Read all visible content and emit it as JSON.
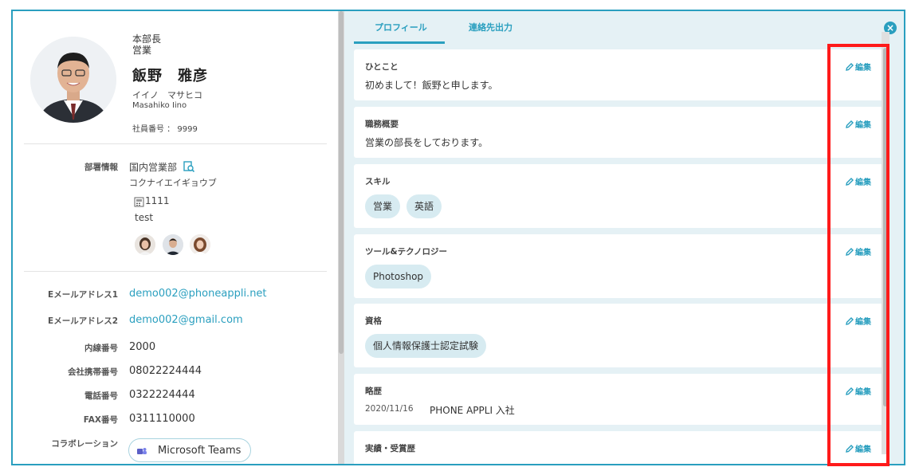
{
  "profile": {
    "position1": "本部長",
    "position2": "営業",
    "name": "飯野　雅彦",
    "kana": "イイノ　マサヒコ",
    "roman": "Masahiko Iino",
    "employee_no": "社員番号 ： 9999"
  },
  "dept": {
    "label": "部署情報",
    "name": "国内営業部",
    "kana": "コクナイエイギョウブ",
    "phone": "1111",
    "link": "test"
  },
  "contacts": [
    {
      "label": "Eメールアドレス1",
      "value": "demo002@phoneappli.net"
    },
    {
      "label": "Eメールアドレス2",
      "value": "demo002@gmail.com"
    },
    {
      "label": "内線番号",
      "value": "2000"
    },
    {
      "label": "会社携帯番号",
      "value": "08022224444"
    },
    {
      "label": "電話番号",
      "value": "0322224444"
    },
    {
      "label": "FAX番号",
      "value": "0311110000"
    },
    {
      "label": "コラボレーション",
      "value": "Microsoft Teams"
    }
  ],
  "tabs": [
    "プロフィール",
    "連絡先出力"
  ],
  "edit_label": "編集",
  "cards": [
    {
      "title": "ひとこと",
      "text": "初めまして！飯野と申します。"
    },
    {
      "title": "職務概要",
      "text": "営業の部長をしております。"
    },
    {
      "title": "スキル",
      "chips": [
        "営業",
        "英語"
      ]
    },
    {
      "title": "ツール&テクノロジー",
      "chips": [
        "Photoshop"
      ]
    },
    {
      "title": "資格",
      "chips": [
        "個人情報保護士認定試験"
      ]
    },
    {
      "title": "略歴",
      "date": "2020/11/16",
      "text": "PHONE APPLI 入社"
    },
    {
      "title": "実績・受賞歴"
    }
  ],
  "colors": {
    "accent": "#2a9fbf",
    "highlight": "#ff1a1a",
    "panel_bg": "#e5f1f5"
  }
}
